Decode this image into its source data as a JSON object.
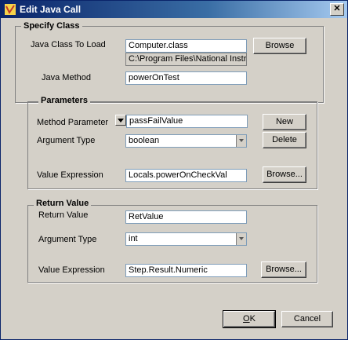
{
  "window": {
    "title": "Edit Java Call",
    "close_glyph": "✕"
  },
  "specify_class": {
    "title": "Specify Class",
    "java_class_label": "Java Class To Load",
    "java_class_value": "Computer.class",
    "java_class_path": "C:\\Program Files\\National Instruments\\",
    "browse_label": "Browse",
    "java_method_label": "Java Method",
    "java_method_value": "powerOnTest"
  },
  "parameters": {
    "title": "Parameters",
    "method_parameter_label": "Method Parameter",
    "method_parameter_value": "passFailValue",
    "new_label": "New",
    "argument_type_label": "Argument Type",
    "argument_type_value": "boolean",
    "delete_label": "Delete",
    "value_expression_label": "Value Expression",
    "value_expression_value": "Locals.powerOnCheckVal",
    "browse_label": "Browse..."
  },
  "return_value": {
    "title": "Return Value",
    "return_value_label": "Return Value",
    "return_value_value": "RetValue",
    "argument_type_label": "Argument Type",
    "argument_type_value": "int",
    "value_expression_label": "Value Expression",
    "value_expression_value": "Step.Result.Numeric",
    "browse_label": "Browse..."
  },
  "footer": {
    "ok_label": "OK",
    "ok_mnemonic": "O",
    "ok_rest": "K",
    "cancel_label": "Cancel"
  }
}
